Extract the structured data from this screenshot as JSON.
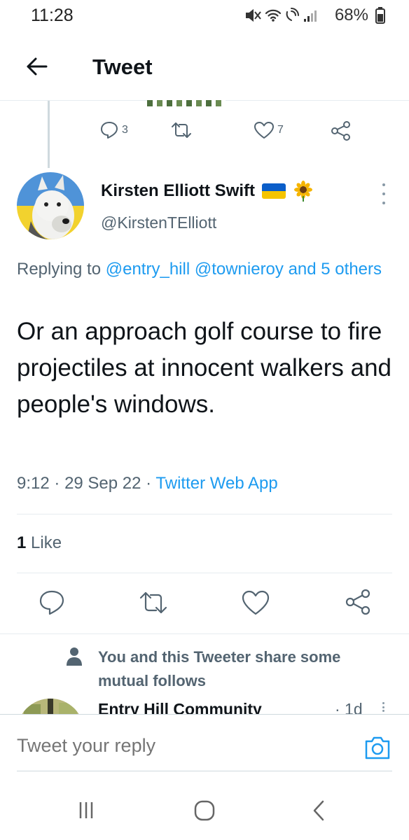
{
  "status_bar": {
    "time": "11:28",
    "battery": "68%"
  },
  "header": {
    "title": "Tweet"
  },
  "previous_tweet": {
    "reply_count": "3",
    "like_count": "7"
  },
  "tweet": {
    "author_name": "Kirsten Elliott Swift",
    "author_handle": "@KirstenTElliott",
    "replying_prefix": "Replying to",
    "replying_mentions": "@entry_hill @townieroy and 5 others",
    "text": "Or an approach golf course to fire projectiles at innocent walkers and people's windows.",
    "time": "9:12",
    "date": "29 Sep 22",
    "source": "Twitter Web App",
    "like_count": "1",
    "like_label": "Like"
  },
  "social_context": {
    "text": "You and this Tweeter share some mutual follows"
  },
  "next_reply": {
    "author_name": "Entry Hill Community",
    "time": "· 1d"
  },
  "compose": {
    "placeholder": "Tweet your reply"
  },
  "colors": {
    "accent": "#1d9bf0",
    "secondary_text": "#536471",
    "primary_text": "#0f1419"
  }
}
